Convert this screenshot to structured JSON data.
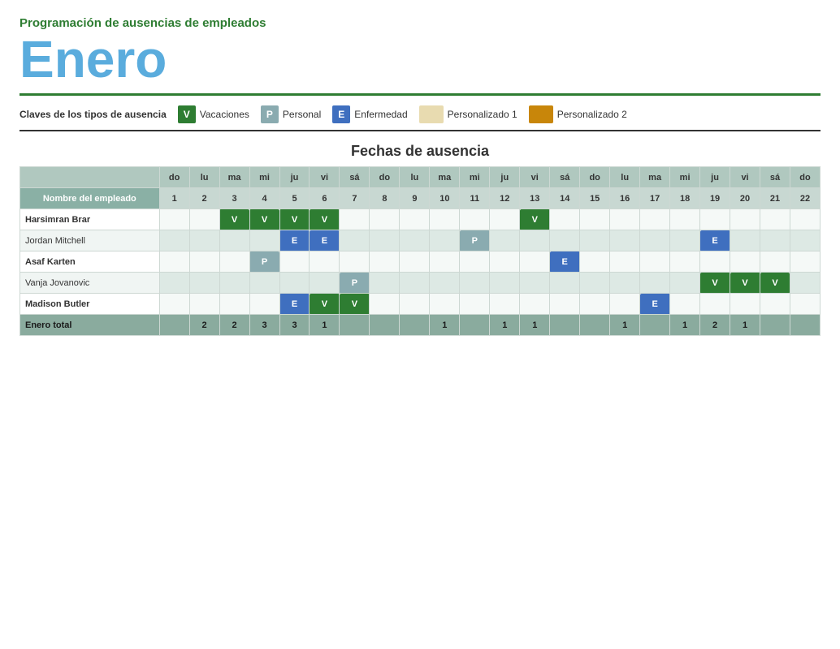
{
  "header": {
    "subtitle": "Programación de ausencias de empleados",
    "title": "Enero"
  },
  "legend": {
    "label": "Claves de los tipos de ausencia",
    "items": [
      {
        "key": "V",
        "label": "Vacaciones",
        "class": "vacaciones"
      },
      {
        "key": "P",
        "label": "Personal",
        "class": "personal"
      },
      {
        "key": "E",
        "label": "Enfermedad",
        "class": "enfermedad"
      },
      {
        "key": "",
        "label": "Personalizado 1",
        "class": "personalizado1"
      },
      {
        "key": "",
        "label": "Personalizado 2",
        "class": "personalizado2"
      }
    ]
  },
  "section_title": "Fechas de ausencia",
  "days_header": [
    "do",
    "lu",
    "ma",
    "mi",
    "ju",
    "vi",
    "sá",
    "do",
    "lu",
    "ma",
    "mi",
    "ju",
    "vi",
    "sá",
    "do",
    "lu",
    "ma",
    "mi",
    "ju",
    "vi",
    "sá",
    "do"
  ],
  "dates_header": [
    1,
    2,
    3,
    4,
    5,
    6,
    7,
    8,
    9,
    10,
    11,
    12,
    13,
    14,
    15,
    16,
    17,
    18,
    19,
    20,
    21,
    22
  ],
  "col_header": "Nombre del empleado",
  "employees": [
    {
      "name": "Harsimran Brar",
      "row_class": "row-odd",
      "cells": [
        "",
        "",
        "V",
        "V",
        "V",
        "V",
        "",
        "",
        "",
        "",
        "",
        "",
        "V",
        "",
        "",
        "",
        "",
        "",
        "",
        "",
        "",
        ""
      ]
    },
    {
      "name": "Jordan Mitchell",
      "row_class": "row-even",
      "cells": [
        "",
        "",
        "",
        "",
        "E",
        "E",
        "",
        "",
        "",
        "",
        "P",
        "",
        "",
        "",
        "",
        "",
        "",
        "",
        "E",
        "",
        "",
        ""
      ]
    },
    {
      "name": "Asaf Karten",
      "row_class": "row-odd",
      "cells": [
        "",
        "",
        "",
        "P",
        "",
        "",
        "",
        "",
        "",
        "",
        "",
        "",
        "",
        "E",
        "",
        "",
        "",
        "",
        "",
        "",
        "",
        ""
      ]
    },
    {
      "name": "Vanja Jovanovic",
      "row_class": "row-even",
      "cells": [
        "",
        "",
        "",
        "",
        "",
        "",
        "P",
        "",
        "",
        "",
        "",
        "",
        "",
        "",
        "",
        "",
        "",
        "",
        "V",
        "V",
        "V",
        ""
      ]
    },
    {
      "name": "Madison Butler",
      "row_class": "row-odd",
      "cells": [
        "",
        "",
        "",
        "",
        "E",
        "V",
        "V",
        "",
        "",
        "",
        "",
        "",
        "",
        "",
        "",
        "",
        "E",
        "",
        "",
        "",
        "",
        ""
      ]
    }
  ],
  "totals": {
    "label": "Enero total",
    "values": [
      "",
      "2",
      "2",
      "3",
      "3",
      "1",
      "",
      "",
      "",
      "1",
      "",
      "1",
      "1",
      "",
      "",
      "1",
      "",
      "1",
      "2",
      "1",
      "",
      ""
    ]
  }
}
